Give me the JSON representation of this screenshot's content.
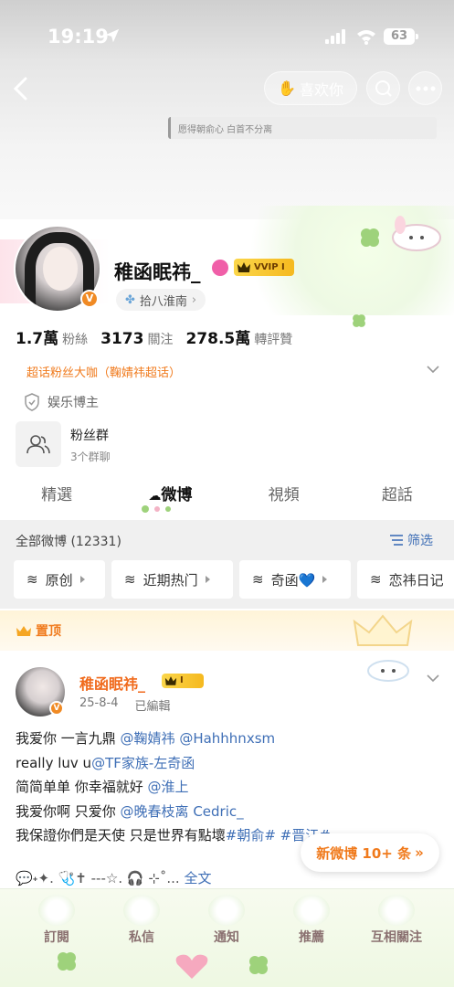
{
  "status": {
    "time": "19:19",
    "battery": "63"
  },
  "header": {
    "like_label": "喜欢你",
    "signature": "愿得朝俞心 白首不分离"
  },
  "profile": {
    "name": "稚函眠祎_",
    "vip_label": "VVIP I",
    "location": "拾八淮南",
    "stats": [
      {
        "value": "1.7萬",
        "label": "粉絲"
      },
      {
        "value": "3173",
        "label": "關注"
      },
      {
        "value": "278.5萬",
        "label": "轉評贊"
      }
    ],
    "super_topic": "超话粉丝大咖（鞠婧祎超话）",
    "role": "娱乐博主",
    "fan_group": {
      "title": "粉丝群",
      "subtitle": "3个群聊"
    }
  },
  "tabs": [
    "精選",
    "微博",
    "視頻",
    "超話"
  ],
  "active_tab": "微博",
  "filter": {
    "all_count": "全部微博 (12331)",
    "filter_label": "筛选",
    "chips": [
      "原创",
      "近期热门",
      "奇函💙",
      "恋祎日记"
    ]
  },
  "pinned": {
    "label": "置顶",
    "post": {
      "name": "稚函眠祎_",
      "vip_level": "I",
      "date": "25-8-4",
      "edited": "已編輯",
      "lines": [
        {
          "text": "我爱你 一言九鼎 ",
          "mention": "@鞠婧祎 @Hahhhnxsm"
        },
        {
          "text": "really luv u",
          "mention": "@TF家族-左奇函"
        },
        {
          "text": "简简单单 你幸福就好 ",
          "mention": "@淮上"
        },
        {
          "text": "我爱你啊 只爱你 ",
          "mention": "@晚春枝离 Cedric_"
        },
        {
          "text": "我保證你們是天使 只是世界有點壞",
          "mention": "#朝俞# #晋江#"
        }
      ],
      "last_line": "💬˖✦. 🩺✝ ---☆. 🎧 ⊹˚... ",
      "full_text": "全文"
    }
  },
  "new_weibo": "新微博 10+ 条",
  "nav": [
    "訂閱",
    "私信",
    "通知",
    "推薦",
    "互相關注"
  ]
}
